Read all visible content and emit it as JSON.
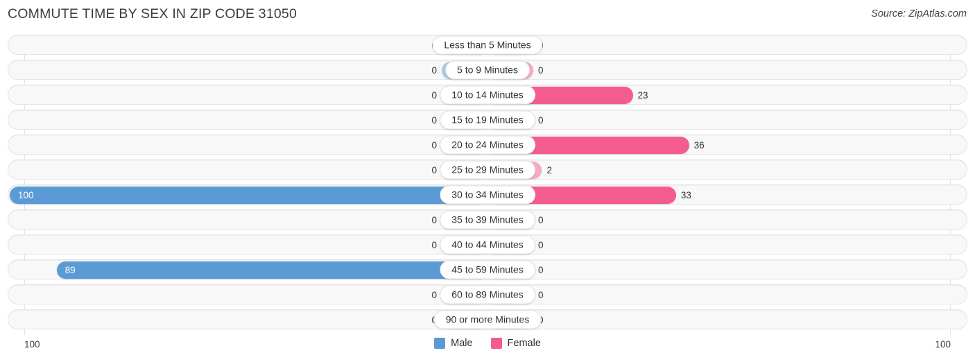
{
  "header": {
    "title": "COMMUTE TIME BY SEX IN ZIP CODE 31050",
    "source": "Source: ZipAtlas.com"
  },
  "axis": {
    "left_label": "100",
    "right_label": "100",
    "max": 100
  },
  "legend": {
    "items": [
      {
        "label": "Male",
        "color": "#5b9bd5"
      },
      {
        "label": "Female",
        "color": "#f45c8f"
      }
    ]
  },
  "colors": {
    "male_light": "#a8c8ec",
    "male_strong": "#5b9bd5",
    "female_light": "#f7a8c4",
    "female_strong": "#f45c8f",
    "row_track": "#f8f8f8",
    "row_border": "#e4e4e4"
  },
  "chart_data": {
    "type": "bar",
    "orientation": "horizontal",
    "style": "diverging-bidirectional",
    "title": "COMMUTE TIME BY SEX IN ZIP CODE 31050",
    "xlabel": "",
    "ylabel": "",
    "xlim": [
      0,
      100
    ],
    "grid": false,
    "legend_position": "bottom-center",
    "categories": [
      "Less than 5 Minutes",
      "5 to 9 Minutes",
      "10 to 14 Minutes",
      "15 to 19 Minutes",
      "20 to 24 Minutes",
      "25 to 29 Minutes",
      "30 to 34 Minutes",
      "35 to 39 Minutes",
      "40 to 44 Minutes",
      "45 to 59 Minutes",
      "60 to 89 Minutes",
      "90 or more Minutes"
    ],
    "series": [
      {
        "name": "Male",
        "color": "#5b9bd5",
        "values": [
          0,
          0,
          0,
          0,
          0,
          0,
          100,
          0,
          0,
          89,
          0,
          0
        ]
      },
      {
        "name": "Female",
        "color": "#f45c8f",
        "values": [
          0,
          0,
          23,
          0,
          36,
          2,
          33,
          0,
          0,
          0,
          0,
          0
        ]
      }
    ]
  },
  "rows": [
    {
      "category": "Less than 5 Minutes",
      "male": "0",
      "female": "0",
      "male_value": 0,
      "female_value": 0
    },
    {
      "category": "5 to 9 Minutes",
      "male": "0",
      "female": "0",
      "male_value": 0,
      "female_value": 0
    },
    {
      "category": "10 to 14 Minutes",
      "male": "0",
      "female": "23",
      "male_value": 0,
      "female_value": 23
    },
    {
      "category": "15 to 19 Minutes",
      "male": "0",
      "female": "0",
      "male_value": 0,
      "female_value": 0
    },
    {
      "category": "20 to 24 Minutes",
      "male": "0",
      "female": "36",
      "male_value": 0,
      "female_value": 36
    },
    {
      "category": "25 to 29 Minutes",
      "male": "0",
      "female": "2",
      "male_value": 0,
      "female_value": 2
    },
    {
      "category": "30 to 34 Minutes",
      "male": "100",
      "female": "33",
      "male_value": 100,
      "female_value": 33
    },
    {
      "category": "35 to 39 Minutes",
      "male": "0",
      "female": "0",
      "male_value": 0,
      "female_value": 0
    },
    {
      "category": "40 to 44 Minutes",
      "male": "0",
      "female": "0",
      "male_value": 0,
      "female_value": 0
    },
    {
      "category": "45 to 59 Minutes",
      "male": "89",
      "female": "0",
      "male_value": 89,
      "female_value": 0
    },
    {
      "category": "60 to 89 Minutes",
      "male": "0",
      "female": "0",
      "male_value": 0,
      "female_value": 0
    },
    {
      "category": "90 or more Minutes",
      "male": "0",
      "female": "0",
      "male_value": 0,
      "female_value": 0
    }
  ]
}
